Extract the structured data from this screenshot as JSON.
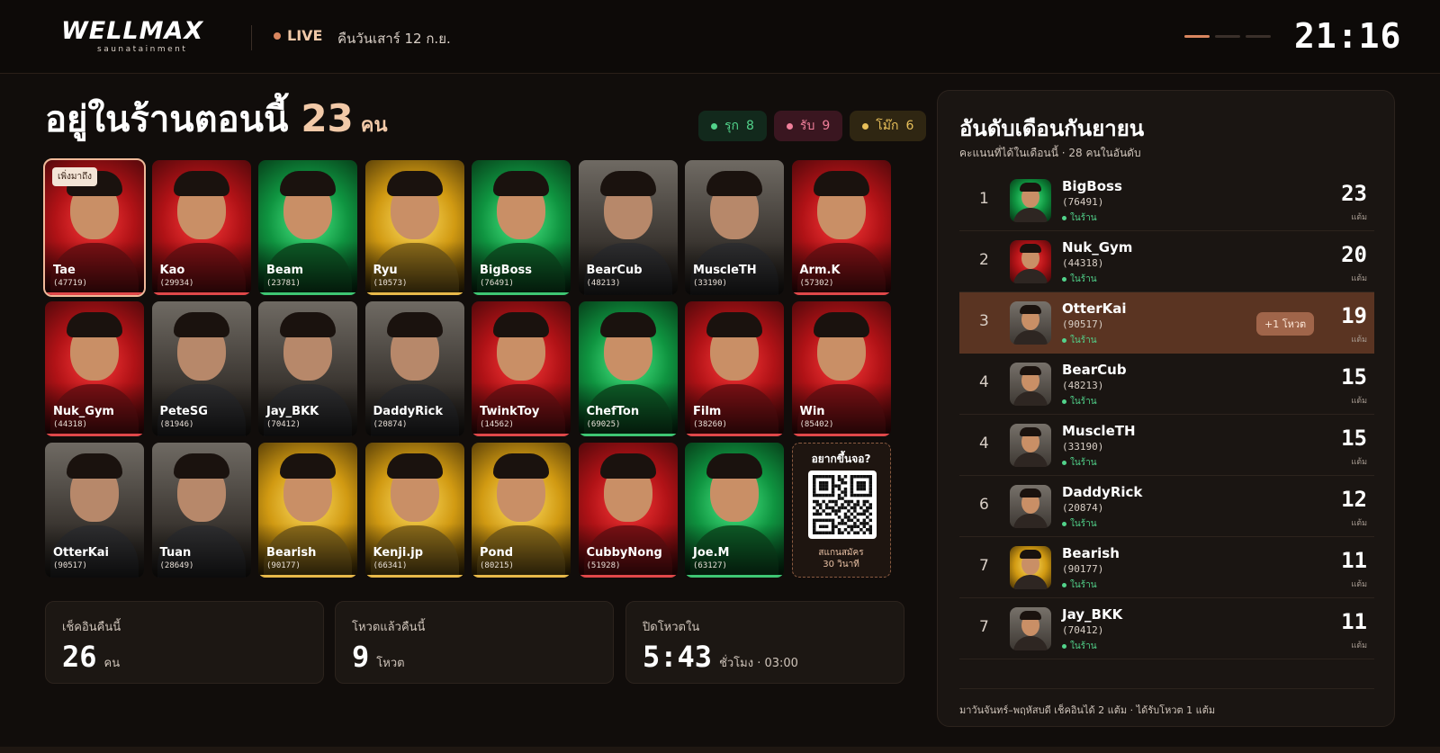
{
  "header": {
    "logo_word": "WELLMAX",
    "logo_sub": "saunatainment",
    "live_label": "LIVE",
    "date_text": "คืนวันเสาร์ 12 ก.ย.",
    "clock": "21:16"
  },
  "main": {
    "title": "อยู่ในร้านตอนนี้",
    "count": "23",
    "count_unit": "คน",
    "pills": [
      {
        "label": "รุก",
        "count": "8",
        "color": "#52d38b"
      },
      {
        "label": "รับ",
        "count": "9",
        "color": "#f07f9a"
      },
      {
        "label": "โม๊ก",
        "count": "6",
        "color": "#e8c05a"
      }
    ],
    "new_badge": "เพิ่งมาถึง",
    "members": [
      {
        "name": "Tae",
        "code": "(47719)",
        "style": "red"
      },
      {
        "name": "Kao",
        "code": "(29934)",
        "style": "red"
      },
      {
        "name": "Beam",
        "code": "(23781)",
        "style": "green"
      },
      {
        "name": "Ryu",
        "code": "(10573)",
        "style": "yellow"
      },
      {
        "name": "BigBoss",
        "code": "(76491)",
        "style": "green"
      },
      {
        "name": "BearCub",
        "code": "(48213)",
        "style": "photo"
      },
      {
        "name": "MuscleTH",
        "code": "(33190)",
        "style": "photo"
      },
      {
        "name": "Arm.K",
        "code": "(57302)",
        "style": "red"
      },
      {
        "name": "Nuk_Gym",
        "code": "(44318)",
        "style": "red"
      },
      {
        "name": "PeteSG",
        "code": "(81946)",
        "style": "photo"
      },
      {
        "name": "Jay_BKK",
        "code": "(70412)",
        "style": "photo"
      },
      {
        "name": "DaddyRick",
        "code": "(20874)",
        "style": "photo"
      },
      {
        "name": "TwinkToy",
        "code": "(14562)",
        "style": "red"
      },
      {
        "name": "ChefTon",
        "code": "(69025)",
        "style": "green"
      },
      {
        "name": "Film",
        "code": "(38260)",
        "style": "red"
      },
      {
        "name": "Win",
        "code": "(85402)",
        "style": "red"
      },
      {
        "name": "OtterKai",
        "code": "(90517)",
        "style": "photo"
      },
      {
        "name": "Tuan",
        "code": "(28649)",
        "style": "photo"
      },
      {
        "name": "Bearish",
        "code": "(90177)",
        "style": "yellow"
      },
      {
        "name": "Kenji.jp",
        "code": "(66341)",
        "style": "yellow"
      },
      {
        "name": "Pond",
        "code": "(80215)",
        "style": "yellow"
      },
      {
        "name": "CubbyNong",
        "code": "(51928)",
        "style": "red"
      },
      {
        "name": "Joe.M",
        "code": "(63127)",
        "style": "green"
      }
    ],
    "qr": {
      "title": "อยากขึ้นจอ?",
      "sub1": "สแกนสมัคร",
      "sub2": "30 วินาที"
    },
    "stats": [
      {
        "label": "เช็คอินคืนนี้",
        "value": "26",
        "unit": "คน"
      },
      {
        "label": "โหวตแล้วคืนนี้",
        "value": "9",
        "unit": "โหวต"
      },
      {
        "label": "ปิดโหวตใน",
        "value": "5:43",
        "unit": "ชั่วโมง · 03:00"
      }
    ]
  },
  "leaderboard": {
    "title": "อันดับเดือนกันยายน",
    "subtitle": "คะแนนที่ได้ในเดือนนี้ · 28 คนในอันดับ",
    "status_label": "ในร้าน",
    "score_unit": "แต้ม",
    "vote_badge": "+1 โหวต",
    "rows": [
      {
        "rank": "1",
        "name": "BigBoss",
        "code": "(76491)",
        "score": "23",
        "style": "green"
      },
      {
        "rank": "2",
        "name": "Nuk_Gym",
        "code": "(44318)",
        "score": "20",
        "style": "red"
      },
      {
        "rank": "3",
        "name": "OtterKai",
        "code": "(90517)",
        "score": "19",
        "style": "photo"
      },
      {
        "rank": "4",
        "name": "BearCub",
        "code": "(48213)",
        "score": "15",
        "style": "photo"
      },
      {
        "rank": "4",
        "name": "MuscleTH",
        "code": "(33190)",
        "score": "15",
        "style": "photo"
      },
      {
        "rank": "6",
        "name": "DaddyRick",
        "code": "(20874)",
        "score": "12",
        "style": "photo"
      },
      {
        "rank": "7",
        "name": "Bearish",
        "code": "(90177)",
        "score": "11",
        "style": "yellow"
      },
      {
        "rank": "7",
        "name": "Jay_BKK",
        "code": "(70412)",
        "score": "11",
        "style": "photo"
      }
    ],
    "footer": "มาวันจันทร์–พฤหัสบดี เช็คอินได้ 2 แต้ม · ได้รับโหวต 1 แต้ม"
  }
}
